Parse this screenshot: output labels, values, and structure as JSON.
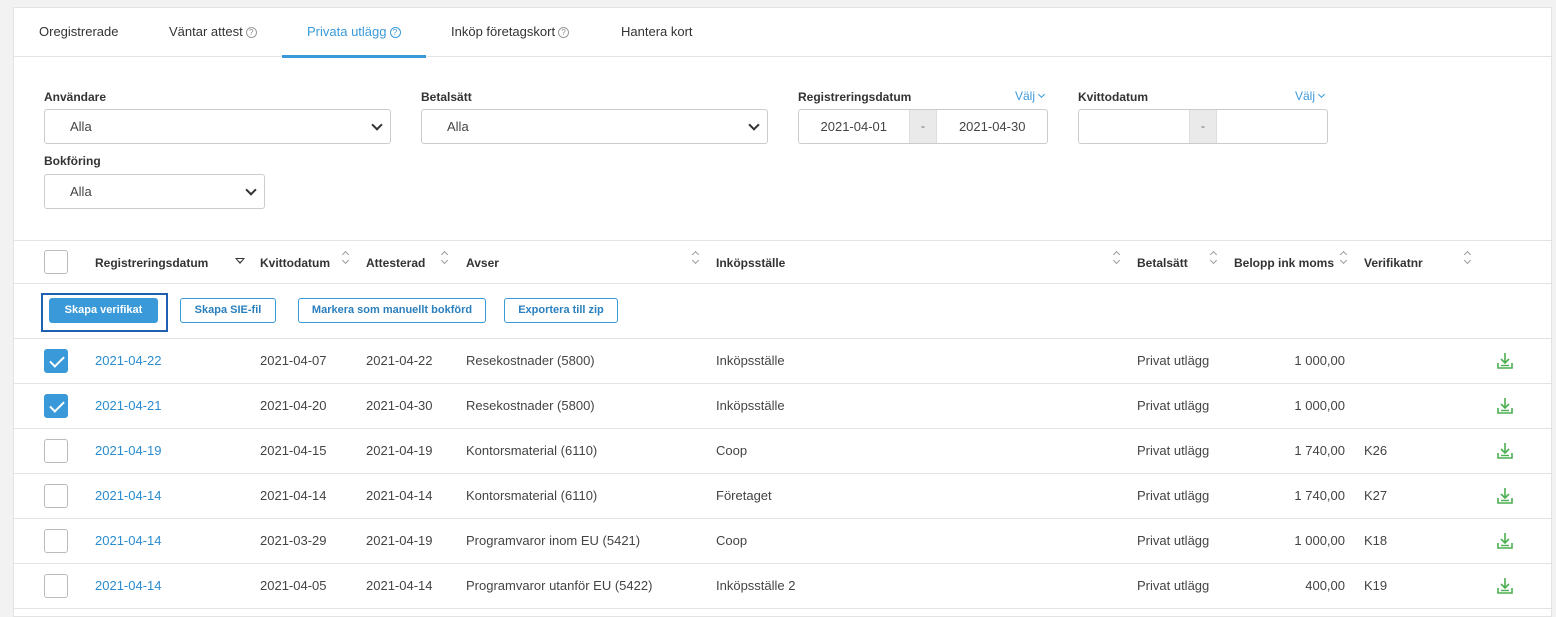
{
  "tabs": [
    {
      "label": "Oregistrerade",
      "help": false
    },
    {
      "label": "Väntar attest",
      "help": true
    },
    {
      "label": "Privata utlägg",
      "help": true,
      "active": true
    },
    {
      "label": "Inköp företagskort",
      "help": true
    },
    {
      "label": "Hantera kort",
      "help": false
    }
  ],
  "filters": {
    "user": {
      "label": "Användare",
      "value": "Alla"
    },
    "payment": {
      "label": "Betalsätt",
      "value": "Alla"
    },
    "regdate": {
      "label": "Registreringsdatum",
      "choose": "Välj",
      "from": "2021-04-01",
      "sep": "-",
      "to": "2021-04-30"
    },
    "receiptdate": {
      "label": "Kvittodatum",
      "choose": "Välj",
      "from": "",
      "sep": "-",
      "to": ""
    },
    "booking": {
      "label": "Bokföring",
      "value": "Alla"
    }
  },
  "columns": {
    "regdate": "Registreringsdatum",
    "receiptdate": "Kvittodatum",
    "attested": "Attesterad",
    "regarding": "Avser",
    "store": "Inköpsställe",
    "payment": "Betalsätt",
    "amount": "Belopp ink moms",
    "voucher": "Verifikatnr"
  },
  "actions": {
    "create_voucher": "Skapa verifikat",
    "create_sie": "Skapa SIE-fil",
    "mark_manual": "Markera som manuellt bokförd",
    "export_zip": "Exportera till zip"
  },
  "rows": [
    {
      "checked": true,
      "regdate": "2021-04-22",
      "receiptdate": "2021-04-07",
      "attested": "2021-04-22",
      "regarding": "Resekostnader (5800)",
      "store": "Inköpsställe",
      "payment": "Privat utlägg",
      "amount": "1 000,00",
      "voucher": ""
    },
    {
      "checked": true,
      "regdate": "2021-04-21",
      "receiptdate": "2021-04-20",
      "attested": "2021-04-30",
      "regarding": "Resekostnader (5800)",
      "store": "Inköpsställe",
      "payment": "Privat utlägg",
      "amount": "1 000,00",
      "voucher": ""
    },
    {
      "checked": false,
      "regdate": "2021-04-19",
      "receiptdate": "2021-04-15",
      "attested": "2021-04-19",
      "regarding": "Kontorsmaterial (6110)",
      "store": "Coop",
      "payment": "Privat utlägg",
      "amount": "1 740,00",
      "voucher": "K26"
    },
    {
      "checked": false,
      "regdate": "2021-04-14",
      "receiptdate": "2021-04-14",
      "attested": "2021-04-14",
      "regarding": "Kontorsmaterial (6110)",
      "store": "Företaget",
      "payment": "Privat utlägg",
      "amount": "1 740,00",
      "voucher": "K27"
    },
    {
      "checked": false,
      "regdate": "2021-04-14",
      "receiptdate": "2021-03-29",
      "attested": "2021-04-19",
      "regarding": "Programvaror inom EU (5421)",
      "store": "Coop",
      "payment": "Privat utlägg",
      "amount": "1 000,00",
      "voucher": "K18"
    },
    {
      "checked": false,
      "regdate": "2021-04-14",
      "receiptdate": "2021-04-05",
      "attested": "2021-04-14",
      "regarding": "Programvaror utanför EU (5422)",
      "store": "Inköpsställe 2",
      "payment": "Privat utlägg",
      "amount": "400,00",
      "voucher": "K19"
    }
  ],
  "colors": {
    "accent": "#3a9ad9",
    "link": "#2a8ccf",
    "download": "#4caf50"
  }
}
